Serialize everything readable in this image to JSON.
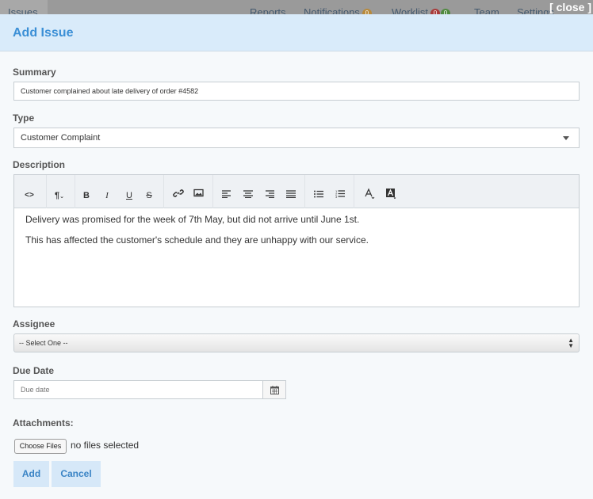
{
  "background_nav": {
    "active_tab": "Issues",
    "items": [
      "Reports",
      "Notifications",
      "Worklist",
      "Team",
      "Settings"
    ],
    "notifications_count": "0",
    "worklist_counts": [
      "0",
      "0"
    ]
  },
  "close_label": "[ close ]",
  "modal": {
    "title": "Add Issue"
  },
  "summary": {
    "label": "Summary",
    "value": "Customer complained about late delivery of order #4582"
  },
  "type": {
    "label": "Type",
    "selected": "Customer Complaint"
  },
  "description": {
    "label": "Description",
    "toolbar": [
      "code-view",
      "paragraph-style",
      "bold",
      "italic",
      "underline",
      "strikethrough",
      "link",
      "image",
      "align-left",
      "align-center",
      "align-right",
      "justify",
      "bulleted-list",
      "numbered-list",
      "font-color",
      "highlight-color"
    ],
    "paragraphs": [
      "Delivery was promised for the week of 7th May, but did not arrive until June 1st.",
      "This has affected the customer's schedule and they are unhappy with our service."
    ]
  },
  "assignee": {
    "label": "Assignee",
    "selected": "-- Select One --"
  },
  "due_date": {
    "label": "Due Date",
    "placeholder": "Due date"
  },
  "attachments": {
    "label": "Attachments:",
    "choose_label": "Choose Files",
    "status": "no files selected"
  },
  "actions": {
    "add": "Add",
    "cancel": "Cancel"
  },
  "colors": {
    "header_bg": "#d9ebfa",
    "accent": "#3b8fd6",
    "button_bg": "#d6e8f8",
    "modal_bg": "#f6f9fb"
  }
}
